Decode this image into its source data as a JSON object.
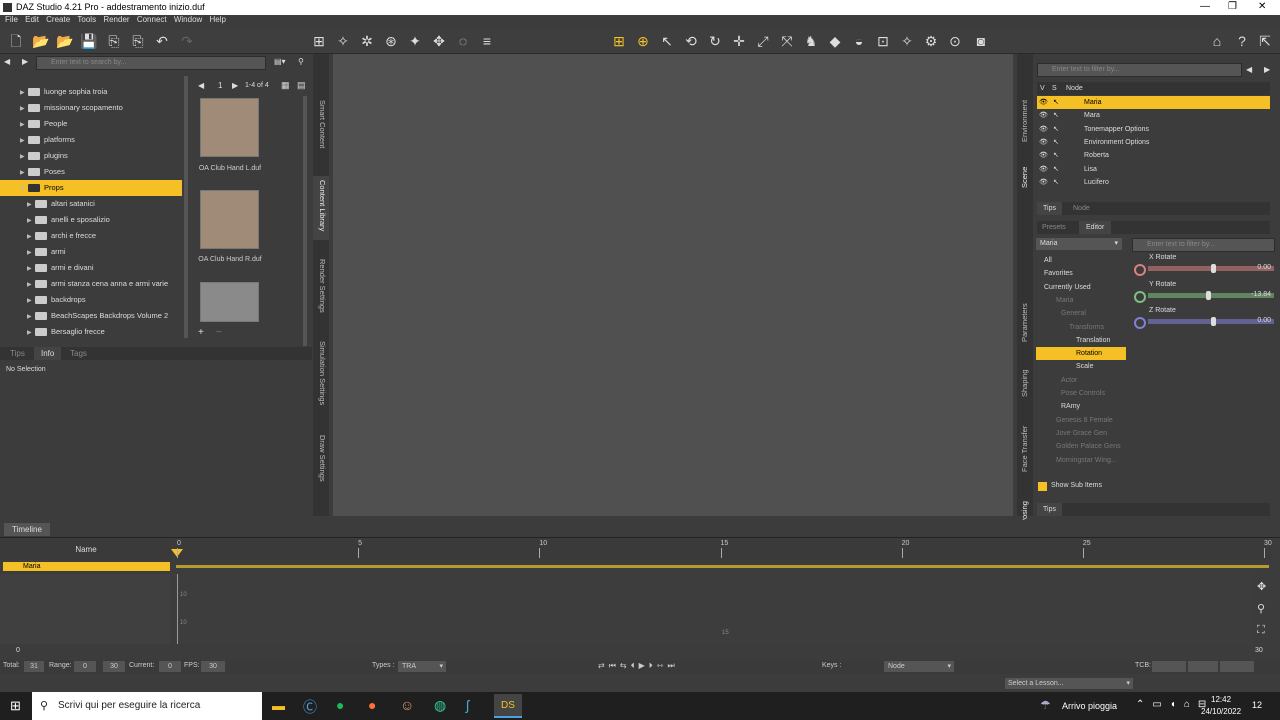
{
  "window": {
    "title": "DAZ Studio 4.21 Pro - addestramento inizio.duf"
  },
  "menu": [
    "File",
    "Edit",
    "Create",
    "Tools",
    "Render",
    "Connect",
    "Window",
    "Help"
  ],
  "content_library": {
    "search_placeholder": "Enter text to search by...",
    "folders": [
      {
        "label": "luonge sophia troia",
        "sel": false,
        "indent": 0
      },
      {
        "label": "missionary scopamento",
        "sel": false,
        "indent": 0
      },
      {
        "label": "People",
        "sel": false,
        "indent": 0
      },
      {
        "label": "platforms",
        "sel": false,
        "indent": 0
      },
      {
        "label": "plugins",
        "sel": false,
        "indent": 0
      },
      {
        "label": "Poses",
        "sel": false,
        "indent": 0
      },
      {
        "label": "Props",
        "sel": true,
        "indent": 0
      },
      {
        "label": "altari satanici",
        "sel": false,
        "indent": 1
      },
      {
        "label": "anelli e sposalizio",
        "sel": false,
        "indent": 1
      },
      {
        "label": "archi e frecce",
        "sel": false,
        "indent": 1
      },
      {
        "label": "armi",
        "sel": false,
        "indent": 1
      },
      {
        "label": "armi e divani",
        "sel": false,
        "indent": 1
      },
      {
        "label": "armi stanza cena anna e armi varie",
        "sel": false,
        "indent": 1
      },
      {
        "label": "backdrops",
        "sel": false,
        "indent": 1
      },
      {
        "label": "BeachScapes Backdrops Volume 2",
        "sel": false,
        "indent": 1
      },
      {
        "label": "Bersaglio frecce",
        "sel": false,
        "indent": 1
      }
    ],
    "page": "1",
    "range": "1-4 of 4",
    "items": [
      {
        "label": "OA Club Hand L.duf"
      },
      {
        "label": "OA Club Hand R.duf"
      }
    ],
    "tabs": [
      "Tips",
      "Info",
      "Tags"
    ],
    "info_text": "No Selection",
    "side_tabs": [
      "Smart Content",
      "Content Library",
      "Render Settings",
      "Simulation Settings",
      "Draw Settings"
    ]
  },
  "scene": {
    "filter_placeholder": "Enter text to filter by...",
    "header": {
      "v": "V",
      "s": "S",
      "node": "Node"
    },
    "nodes": [
      {
        "label": "Maria",
        "sel": true
      },
      {
        "label": "Mara",
        "sel": false
      },
      {
        "label": "Tonemapper Options",
        "sel": false
      },
      {
        "label": "Environment Options",
        "sel": false
      },
      {
        "label": "Roberta",
        "sel": false
      },
      {
        "label": "Lisa",
        "sel": false
      },
      {
        "label": "Lucifero",
        "sel": false
      }
    ],
    "bottom_tabs": [
      "Tips",
      "Node"
    ],
    "side_tabs": [
      "Environment",
      "Scene"
    ]
  },
  "parameters": {
    "tabs": [
      "Presets",
      "Editor"
    ],
    "node_select": "Maria",
    "filter_placeholder": "Enter text to filter by...",
    "groups": [
      {
        "label": "All",
        "cls": ""
      },
      {
        "label": "Favorites",
        "cls": ""
      },
      {
        "label": "Currently Used",
        "cls": ""
      },
      {
        "label": "Maria",
        "cls": "dim"
      },
      {
        "label": "General",
        "cls": "dim"
      },
      {
        "label": "Transforms",
        "cls": "dim"
      },
      {
        "label": "Translation",
        "cls": ""
      },
      {
        "label": "Rotation",
        "cls": "sel"
      },
      {
        "label": "Scale",
        "cls": ""
      },
      {
        "label": "Actor",
        "cls": "dim"
      },
      {
        "label": "Pose Controls",
        "cls": "dim"
      },
      {
        "label": "RAmy",
        "cls": ""
      },
      {
        "label": "Genesis 8 Female",
        "cls": "dim"
      },
      {
        "label": "Jove Grace Gen",
        "cls": "dim"
      },
      {
        "label": "Golden Palace Gens",
        "cls": "dim"
      },
      {
        "label": "Morningstar Wing...",
        "cls": "dim"
      }
    ],
    "sliders": [
      {
        "label": "X Rotate",
        "value": "0.00",
        "color": "#d98080",
        "level": 0.5
      },
      {
        "label": "Y Rotate",
        "value": "-13.84",
        "color": "#7fc07f",
        "level": 0.46
      },
      {
        "label": "Z Rotate",
        "value": "0.00",
        "color": "#8080d9",
        "level": 0.5
      }
    ],
    "show_sub_items": "Show Sub Items",
    "bottom_tab": "Tips",
    "side_tabs": [
      "Parameters",
      "Shaping",
      "Face Transfer",
      "Posing"
    ]
  },
  "timeline": {
    "tab": "Timeline",
    "name_header": "Name",
    "track": "Maria",
    "ticks": [
      "0",
      "5",
      "10",
      "15",
      "20",
      "25",
      "30"
    ],
    "curve_labels": [
      "10",
      "10",
      "15"
    ],
    "start": "0",
    "end": "30"
  },
  "statusbar": {
    "total_label": "Total:",
    "total": "31",
    "range_label": "Range:",
    "range_start": "0",
    "range_end": "30",
    "current_label": "Current:",
    "current": "0",
    "fps_label": "FPS:",
    "fps": "30",
    "types_label": "Types :",
    "types": "TRA",
    "keys_label": "Keys :",
    "keys_node": "Node",
    "tcb_label": "TCB:",
    "lesson": "Select a Lesson..."
  },
  "taskbar": {
    "search_placeholder": "Scrivi qui per eseguire la ricerca",
    "weather": "Arrivo pioggia",
    "time": "12:42",
    "date": "24/10/2022",
    "notifications": "12"
  }
}
